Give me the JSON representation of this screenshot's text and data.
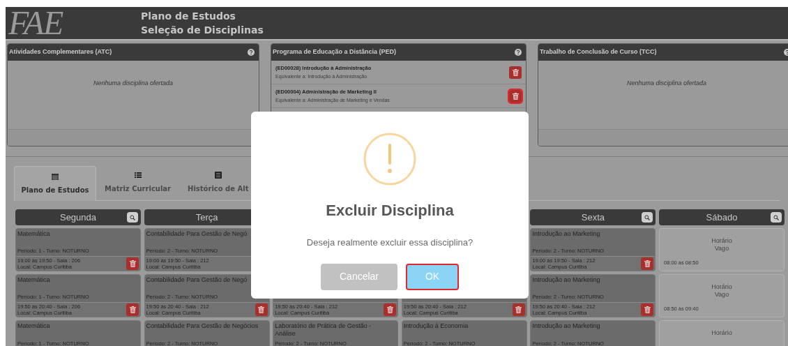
{
  "header": {
    "logo": "FAE",
    "title_lines": [
      "Plano de Estudos",
      "Seleção de Disciplinas"
    ]
  },
  "panels": [
    {
      "title": "Atividades Complementares (ATC)",
      "empty_text": "Nenhuma disciplina ofertada"
    },
    {
      "title": "Programa de Educação a Distância (PED)",
      "items": [
        {
          "title": "(ED00028) Introdução à Administração",
          "equivalent": "Equivalente a: Introdução à Administração",
          "focused": false
        },
        {
          "title": "(ED00004) Administração de Marketing II",
          "equivalent": "Equivalente a: Administração de Marketing e Vendas",
          "focused": true
        }
      ]
    },
    {
      "title": "Trabalho de Conclusão de Curso (TCC)",
      "empty_text": "Nenhuma disciplina ofertada"
    }
  ],
  "tabs": [
    {
      "label": "Plano de Estudos",
      "selected": true
    },
    {
      "label": "Matriz Curricular",
      "selected": false
    },
    {
      "label": "Histórico de Alt",
      "selected": false
    }
  ],
  "days": [
    {
      "name": "Segunda",
      "search": true,
      "slots": [
        {
          "kind": "class",
          "title": "Matemática",
          "period": "Período: 1 - Turno: NOTURNO",
          "time": "19:00 às 19:50 - Sala : 206",
          "location": "Local: Campus Curitiba",
          "delete": true
        },
        {
          "kind": "class",
          "title": "Matemática",
          "period": "Período: 1 - Turno: NOTURNO",
          "time": "19:50 às 20:40 - Sala : 206",
          "location": "Local: Campus Curitiba",
          "delete": true
        },
        {
          "kind": "class",
          "title": "Matemática",
          "period": "Período: 1 - Turno: NOTURNO"
        }
      ]
    },
    {
      "name": "Terça",
      "search": false,
      "slots": [
        {
          "kind": "class",
          "title": "Contabilidade Para Gestão de Negó",
          "period": "Período: 2 - Turno: NOTURNO",
          "time": "19:00 às 19:50 - Sala : 212",
          "location": "Local: Campus Curitiba",
          "delete": false
        },
        {
          "kind": "class",
          "title": "Contabilidade Para Gestão de Negó",
          "period": "Período: 2 - Turno: NOTURNO",
          "time": "19:50 às 20:40 - Sala : 212",
          "location": "Local: Campus Curitiba",
          "delete": true
        },
        {
          "kind": "class",
          "title": "Contabilidade Para Gestão de Negócios",
          "period": "Período: 2 - Turno: NOTURNO"
        }
      ]
    },
    {
      "slots": [
        {
          "kind": "covered"
        },
        {
          "kind": "class",
          "time": "19:50 às 20:40 - Sala : 212",
          "location": "Local: Campus Curitiba",
          "delete": true
        },
        {
          "kind": "class",
          "title": "Laboratório de Prática de Gestão - Análise",
          "period": "Período: 2 - Turno: NOTURNO"
        }
      ]
    },
    {
      "slots": [
        {
          "kind": "covered"
        },
        {
          "kind": "class",
          "time": "19:50 às 20:40 - Sala : 212",
          "location": "Local: Campus Curitiba",
          "delete": true
        },
        {
          "kind": "class",
          "title": "Introdução à Economia",
          "period": "Período: 2 - Turno: NOTURNO"
        }
      ]
    },
    {
      "name": "Sexta",
      "search": true,
      "slots": [
        {
          "kind": "class",
          "title": "Introdução ao Marketing",
          "period": "Período: 2 - Turno: NOTURNO",
          "time": "19:00 às 19:50 - Sala : 212",
          "location": "Local: Campus Curitiba",
          "delete": true
        },
        {
          "kind": "class",
          "title": "Introdução ao Marketing",
          "period": "Período: 2 - Turno: NOTURNO",
          "time": "19:50 às 20:40 - Sala : 212",
          "location": "Local: Campus Curitiba",
          "delete": true
        },
        {
          "kind": "class",
          "title": "Introdução ao Marketing",
          "period": "Período: 2 - Turno: NOTURNO"
        }
      ]
    },
    {
      "name": "Sábado",
      "search": true,
      "slots": [
        {
          "kind": "vacant",
          "status_lines": [
            "Horário",
            "Vago"
          ],
          "time": "08:00 às 08:50"
        },
        {
          "kind": "vacant",
          "status_lines": [
            "Horário",
            "Vago"
          ],
          "time": "08:50 às 09:40"
        },
        {
          "kind": "vacant",
          "status_lines": [
            "Horário"
          ]
        }
      ]
    }
  ],
  "dialog": {
    "title": "Excluir Disciplina",
    "message": "Deseja realmente excluir essa disciplina?",
    "buttons": [
      {
        "label": "Cancelar",
        "kind": "cancel",
        "focused": false
      },
      {
        "label": "OK",
        "kind": "confirm",
        "focused": true
      }
    ]
  }
}
